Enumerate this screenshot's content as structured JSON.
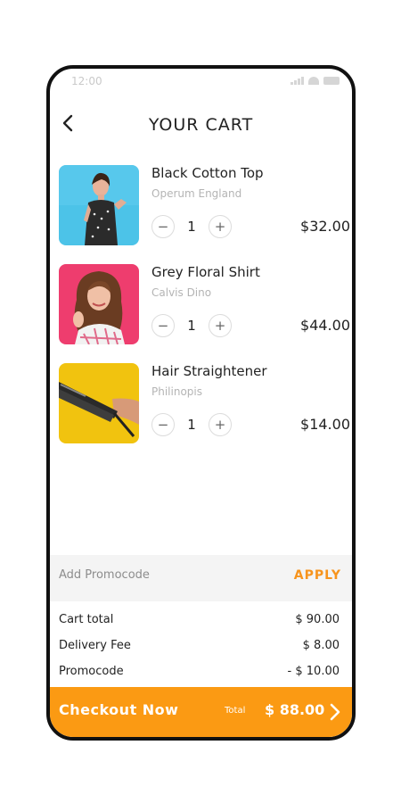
{
  "status": {
    "time": "12:00"
  },
  "header": {
    "title": "YOUR CART"
  },
  "cart": {
    "items": [
      {
        "name": "Black Cotton Top",
        "brand": "Operum England",
        "quantity": "1",
        "price": "$32.00"
      },
      {
        "name": "Grey Floral Shirt",
        "brand": "Calvis Dino",
        "quantity": "1",
        "price": "$44.00"
      },
      {
        "name": "Hair Straightener",
        "brand": "Philinopis",
        "quantity": "1",
        "price": "$14.00"
      }
    ]
  },
  "promo": {
    "placeholder": "Add Promocode",
    "apply_label": "APPLY"
  },
  "summary": {
    "cart_total_label": "Cart total",
    "cart_total": "$ 90.00",
    "delivery_label": "Delivery Fee",
    "delivery": "$ 8.00",
    "promo_label": "Promocode",
    "promo": "- $ 10.00"
  },
  "checkout": {
    "label": "Checkout  Now",
    "total_label": "Total",
    "total": "$ 88.00"
  },
  "colors": {
    "accent": "#fb9a13",
    "apply": "#f7941d",
    "muted": "#b4b4b4"
  }
}
